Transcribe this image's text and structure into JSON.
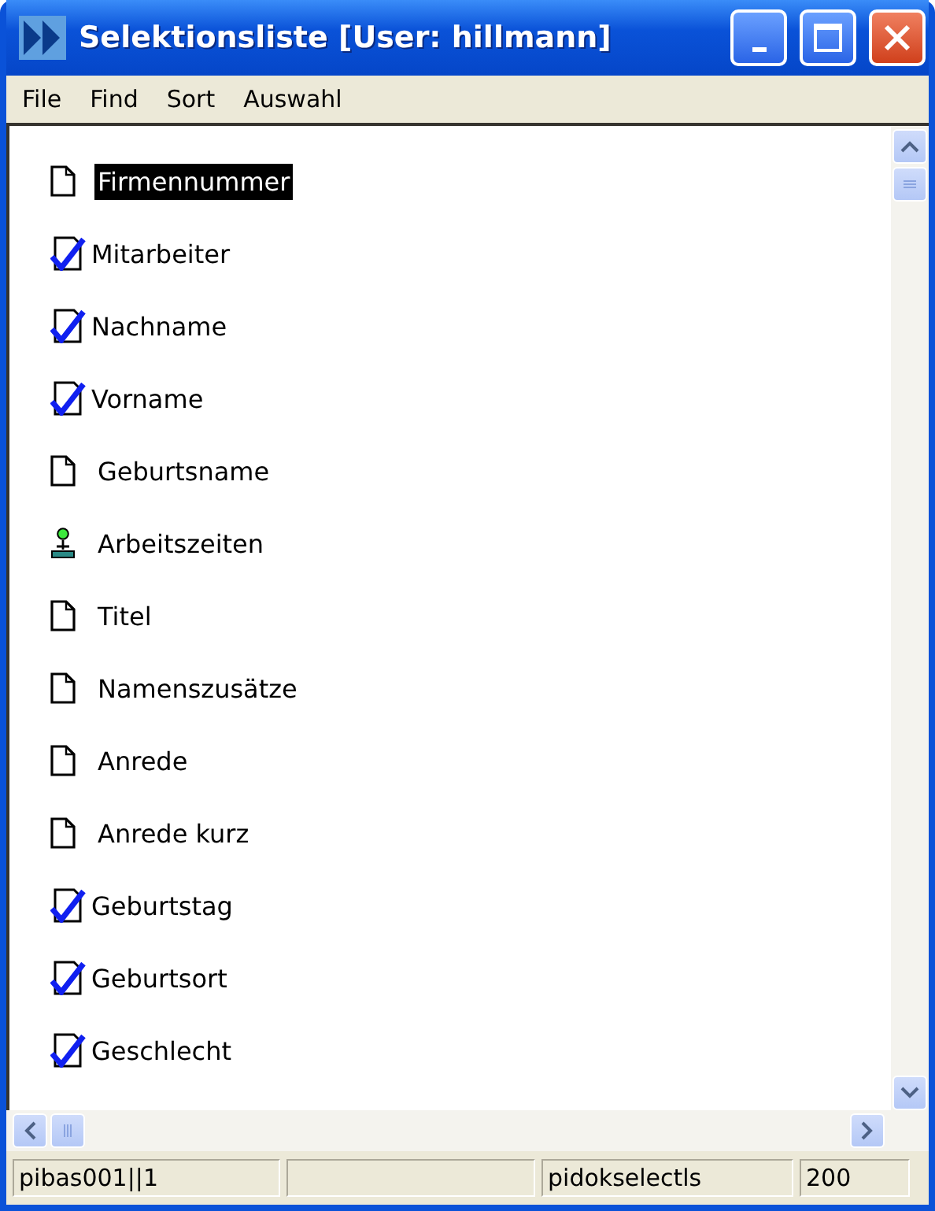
{
  "window": {
    "title": "Selektionsliste [User: hillmann]"
  },
  "menu": [
    "File",
    "Find",
    "Sort",
    "Auswahl"
  ],
  "items": [
    {
      "label": "Firmennummer",
      "kind": "document",
      "checked": false,
      "selected": true
    },
    {
      "label": "Mitarbeiter",
      "kind": "document",
      "checked": true,
      "selected": false
    },
    {
      "label": "Nachname",
      "kind": "document",
      "checked": true,
      "selected": false
    },
    {
      "label": "Vorname",
      "kind": "document",
      "checked": true,
      "selected": false
    },
    {
      "label": "Geburtsname",
      "kind": "document",
      "checked": false,
      "selected": false
    },
    {
      "label": "Arbeitszeiten",
      "kind": "person",
      "checked": false,
      "selected": false
    },
    {
      "label": "Titel",
      "kind": "document",
      "checked": false,
      "selected": false
    },
    {
      "label": "Namenszusätze",
      "kind": "document",
      "checked": false,
      "selected": false
    },
    {
      "label": "Anrede",
      "kind": "document",
      "checked": false,
      "selected": false
    },
    {
      "label": "Anrede kurz",
      "kind": "document",
      "checked": false,
      "selected": false
    },
    {
      "label": "Geburtstag",
      "kind": "document",
      "checked": true,
      "selected": false
    },
    {
      "label": "Geburtsort",
      "kind": "document",
      "checked": true,
      "selected": false
    },
    {
      "label": "Geschlecht",
      "kind": "document",
      "checked": true,
      "selected": false
    }
  ],
  "status_bar": [
    {
      "kind": "text",
      "text": "pibas001||1"
    },
    {
      "kind": "blank"
    },
    {
      "kind": "text",
      "text": "pidokselectls"
    },
    {
      "kind": "text",
      "text": "200"
    }
  ]
}
